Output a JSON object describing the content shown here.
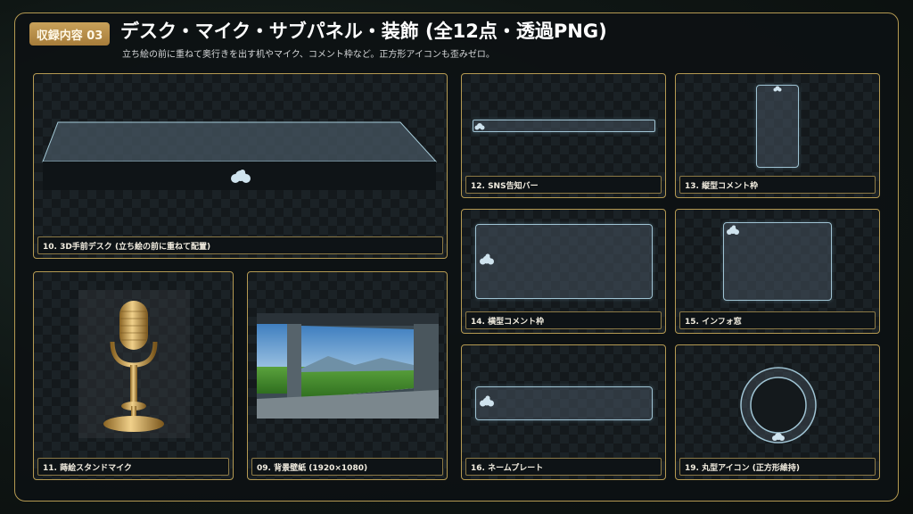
{
  "header": {
    "badge": "収録内容 03",
    "title": "デスク・マイク・サブパネル・装飾 (全12点・透過PNG)",
    "subtitle": "立ち絵の前に重ねて奥行きを出す机やマイク、コメント枠など。正方形アイコンも歪みゼロ。"
  },
  "cards": {
    "desk": "10. 3D手前デスク (立ち絵の前に重ねて配置)",
    "mic": "11. 蒔絵スタンドマイク",
    "wallpaper": "09. 背景壁紙 (1920×1080)",
    "sns_bar": "12. SNS告知バー",
    "vertical_comment": "13. 縦型コメント枠",
    "horizontal_comment": "14. 横型コメント枠",
    "info_window": "15. インフォ窓",
    "name_plate": "16. ネームプレート",
    "round_icon": "19. 丸型アイコン (正方形維持)"
  },
  "colors": {
    "accent_gold": "#b59a52",
    "glass_edge": "#9fc3d3"
  }
}
